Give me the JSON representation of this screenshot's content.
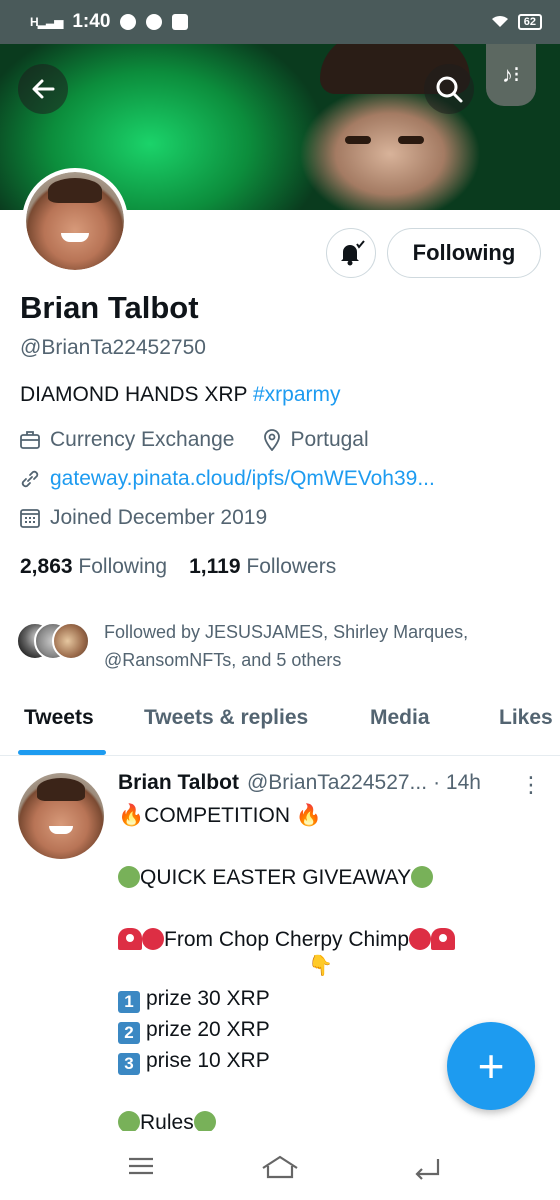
{
  "status_bar": {
    "signal": "H",
    "time": "1:40",
    "battery": "62"
  },
  "profile": {
    "name": "Brian Talbot",
    "handle": "@BrianTa22452750",
    "bio_text": "DIAMOND HANDS XRP",
    "bio_hashtag": "#xrparmy",
    "category": "Currency Exchange",
    "location": "Portugal",
    "link": "gateway.pinata.cloud/ipfs/QmWEVoh39...",
    "joined": "Joined December 2019",
    "following_count": "2,863",
    "following_label": "Following",
    "followers_count": "1,119",
    "followers_label": "Followers",
    "followed_by": "Followed by JESUSJAMES, Shirley Marques, @RansomNFTs, and 5 others",
    "follow_button": "Following"
  },
  "tabs": [
    {
      "label": "Tweets",
      "active": true
    },
    {
      "label": "Tweets & replies",
      "active": false
    },
    {
      "label": "Media",
      "active": false
    },
    {
      "label": "Likes",
      "active": false
    }
  ],
  "tweet": {
    "author": "Brian Talbot",
    "handle": "@BrianTa224527...",
    "time": "· 14h",
    "lines": {
      "competition": "COMPETITION",
      "giveaway": "QUICK EASTER GIVEAWAY",
      "from": "From Chop Cherpy Chimp",
      "prize1": "prize 30 XRP",
      "prize2": "prize 20 XRP",
      "prize3": "prise 10 XRP",
      "rules": "Rules"
    },
    "keycaps": [
      "1",
      "2",
      "3"
    ]
  },
  "fab": {
    "label": "+"
  },
  "colors": {
    "accent": "#1d9bf0",
    "status_bar": "#4a5a5a",
    "secondary_text": "#536471"
  },
  "icons": [
    "back-arrow-icon",
    "search-icon",
    "music-icon",
    "bell-check-icon",
    "briefcase-icon",
    "location-pin-icon",
    "link-icon",
    "calendar-icon",
    "more-vertical-icon",
    "plus-icon",
    "menu-icon",
    "home-icon",
    "back-icon"
  ]
}
